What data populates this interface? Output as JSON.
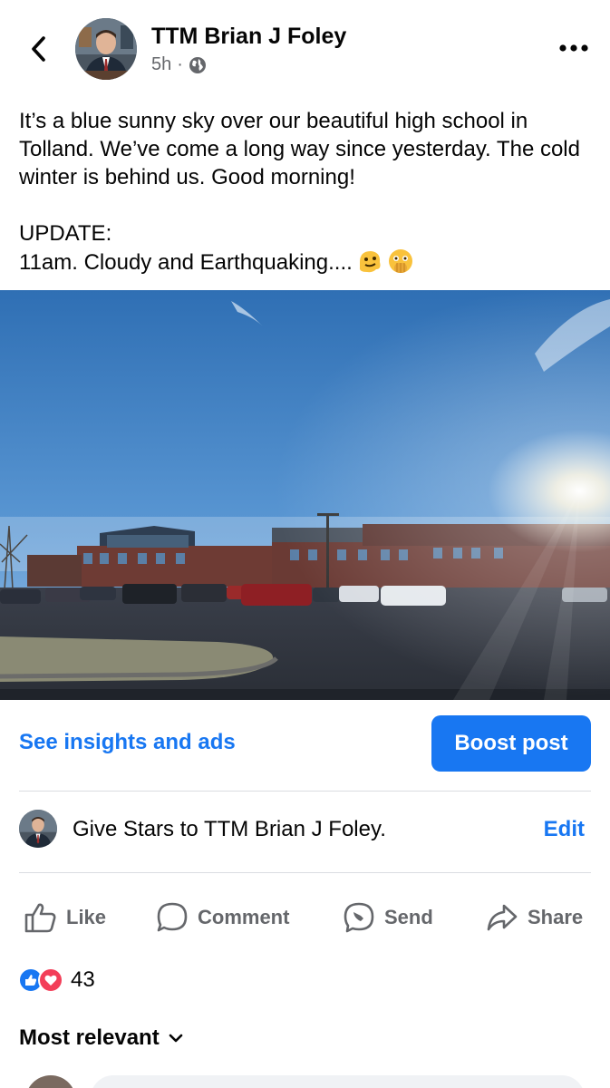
{
  "post": {
    "author": "TTM Brian J Foley",
    "time": "5h",
    "separator": "·",
    "body": "It’s a blue sunny sky over our beautiful high school in Tolland. We’ve come a long way since yesterday. The cold winter is behind us. Good morning!\n\nUPDATE:\n11am. Cloudy and Earthquaking...."
  },
  "actions_bar": {
    "insights_label": "See insights and ads",
    "boost_label": "Boost post"
  },
  "stars": {
    "text": "Give Stars to TTM Brian J Foley.",
    "edit_label": "Edit"
  },
  "buttons": {
    "like": "Like",
    "comment": "Comment",
    "send": "Send",
    "share": "Share"
  },
  "reactions": {
    "count": "43",
    "types": [
      "like",
      "love"
    ]
  },
  "comments": {
    "sort_label": "Most relevant"
  },
  "icons": {
    "back": "back-chevron-icon",
    "more": "more-dots-icon",
    "audience": "globe-icon",
    "like": "thumbs-up-icon",
    "comment": "comment-bubble-icon",
    "send": "messenger-icon",
    "share": "share-arrow-icon",
    "sort": "chevron-down-icon"
  },
  "colors": {
    "accent": "#1877f2",
    "secondary_text": "#65676b",
    "love": "#f33e58"
  }
}
